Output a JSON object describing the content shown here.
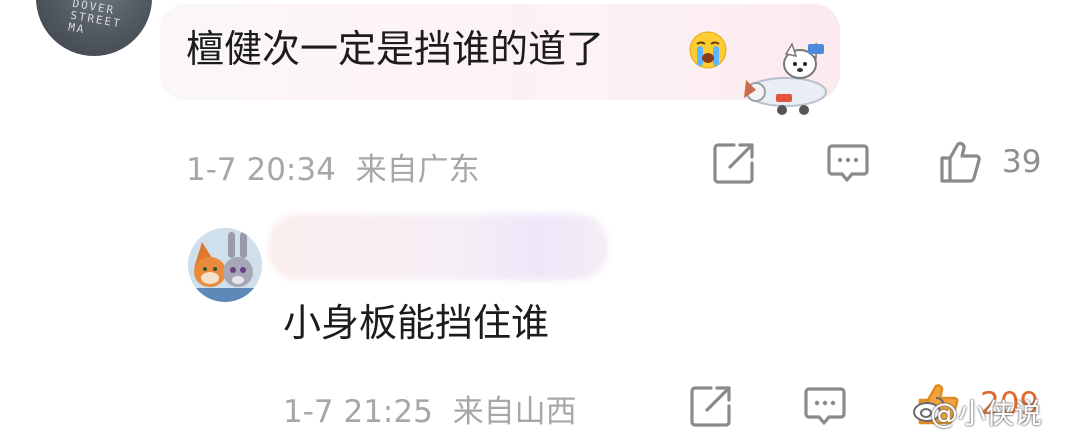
{
  "comment": {
    "text": "檀健次一定是挡谁的道了",
    "emoji": "loudly-crying-face-emoji",
    "sticker": "cartoon-dog-in-airplane-sticker",
    "time": "1-7 20:34",
    "location": "来自广东",
    "like_count": "39"
  },
  "reply": {
    "text": "小身板能挡住谁",
    "time": "1-7 21:25",
    "location": "来自山西",
    "like_count": "209"
  },
  "icons": [
    "share-icon",
    "comment-icon",
    "like-icon"
  ],
  "watermark": "@小侠说",
  "colors": {
    "meta_text": "#a7a7a7",
    "bubble": "#fdf1f3",
    "icon": "#8a8a8a"
  }
}
